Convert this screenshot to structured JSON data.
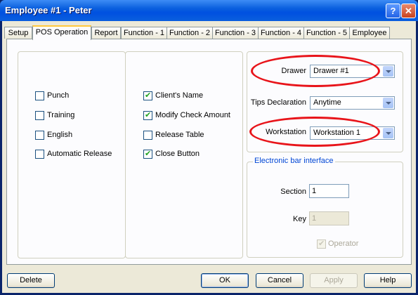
{
  "window": {
    "title": "Employee #1 - Peter",
    "help_btn": "?",
    "close_btn": "✕"
  },
  "tabs": [
    "Setup",
    "POS Operation",
    "Report",
    "Function - 1",
    "Function - 2",
    "Function - 3",
    "Function - 4",
    "Function - 5",
    "Employee"
  ],
  "active_tab": "POS Operation",
  "left_group": {
    "options": [
      {
        "label": "Punch",
        "checked": false
      },
      {
        "label": "Training",
        "checked": false
      },
      {
        "label": "English",
        "checked": false
      },
      {
        "label": "Automatic Release",
        "checked": false
      }
    ]
  },
  "middle_group": {
    "options": [
      {
        "label": "Client's Name",
        "checked": true
      },
      {
        "label": "Modify Check Amount",
        "checked": true
      },
      {
        "label": "Release Table",
        "checked": false
      },
      {
        "label": "Close Button",
        "checked": true
      }
    ]
  },
  "right_group": {
    "drawer": {
      "label": "Drawer",
      "value": "Drawer #1"
    },
    "tips": {
      "label": "Tips Declaration",
      "value": "Anytime"
    },
    "workstation": {
      "label": "Workstation",
      "value": "Workstation  1"
    }
  },
  "ebi": {
    "title": "Electronic bar interface",
    "section": {
      "label": "Section",
      "value": "1"
    },
    "key": {
      "label": "Key",
      "value": "1"
    },
    "operator": {
      "label": "Operator",
      "checked": true
    }
  },
  "buttons": {
    "delete": "Delete",
    "ok": "OK",
    "cancel": "Cancel",
    "apply": "Apply",
    "help": "Help"
  },
  "colors": {
    "highlight_ring": "#e8141a",
    "titlebar": "#0a5fde",
    "tab_accent": "#ffc83c"
  }
}
